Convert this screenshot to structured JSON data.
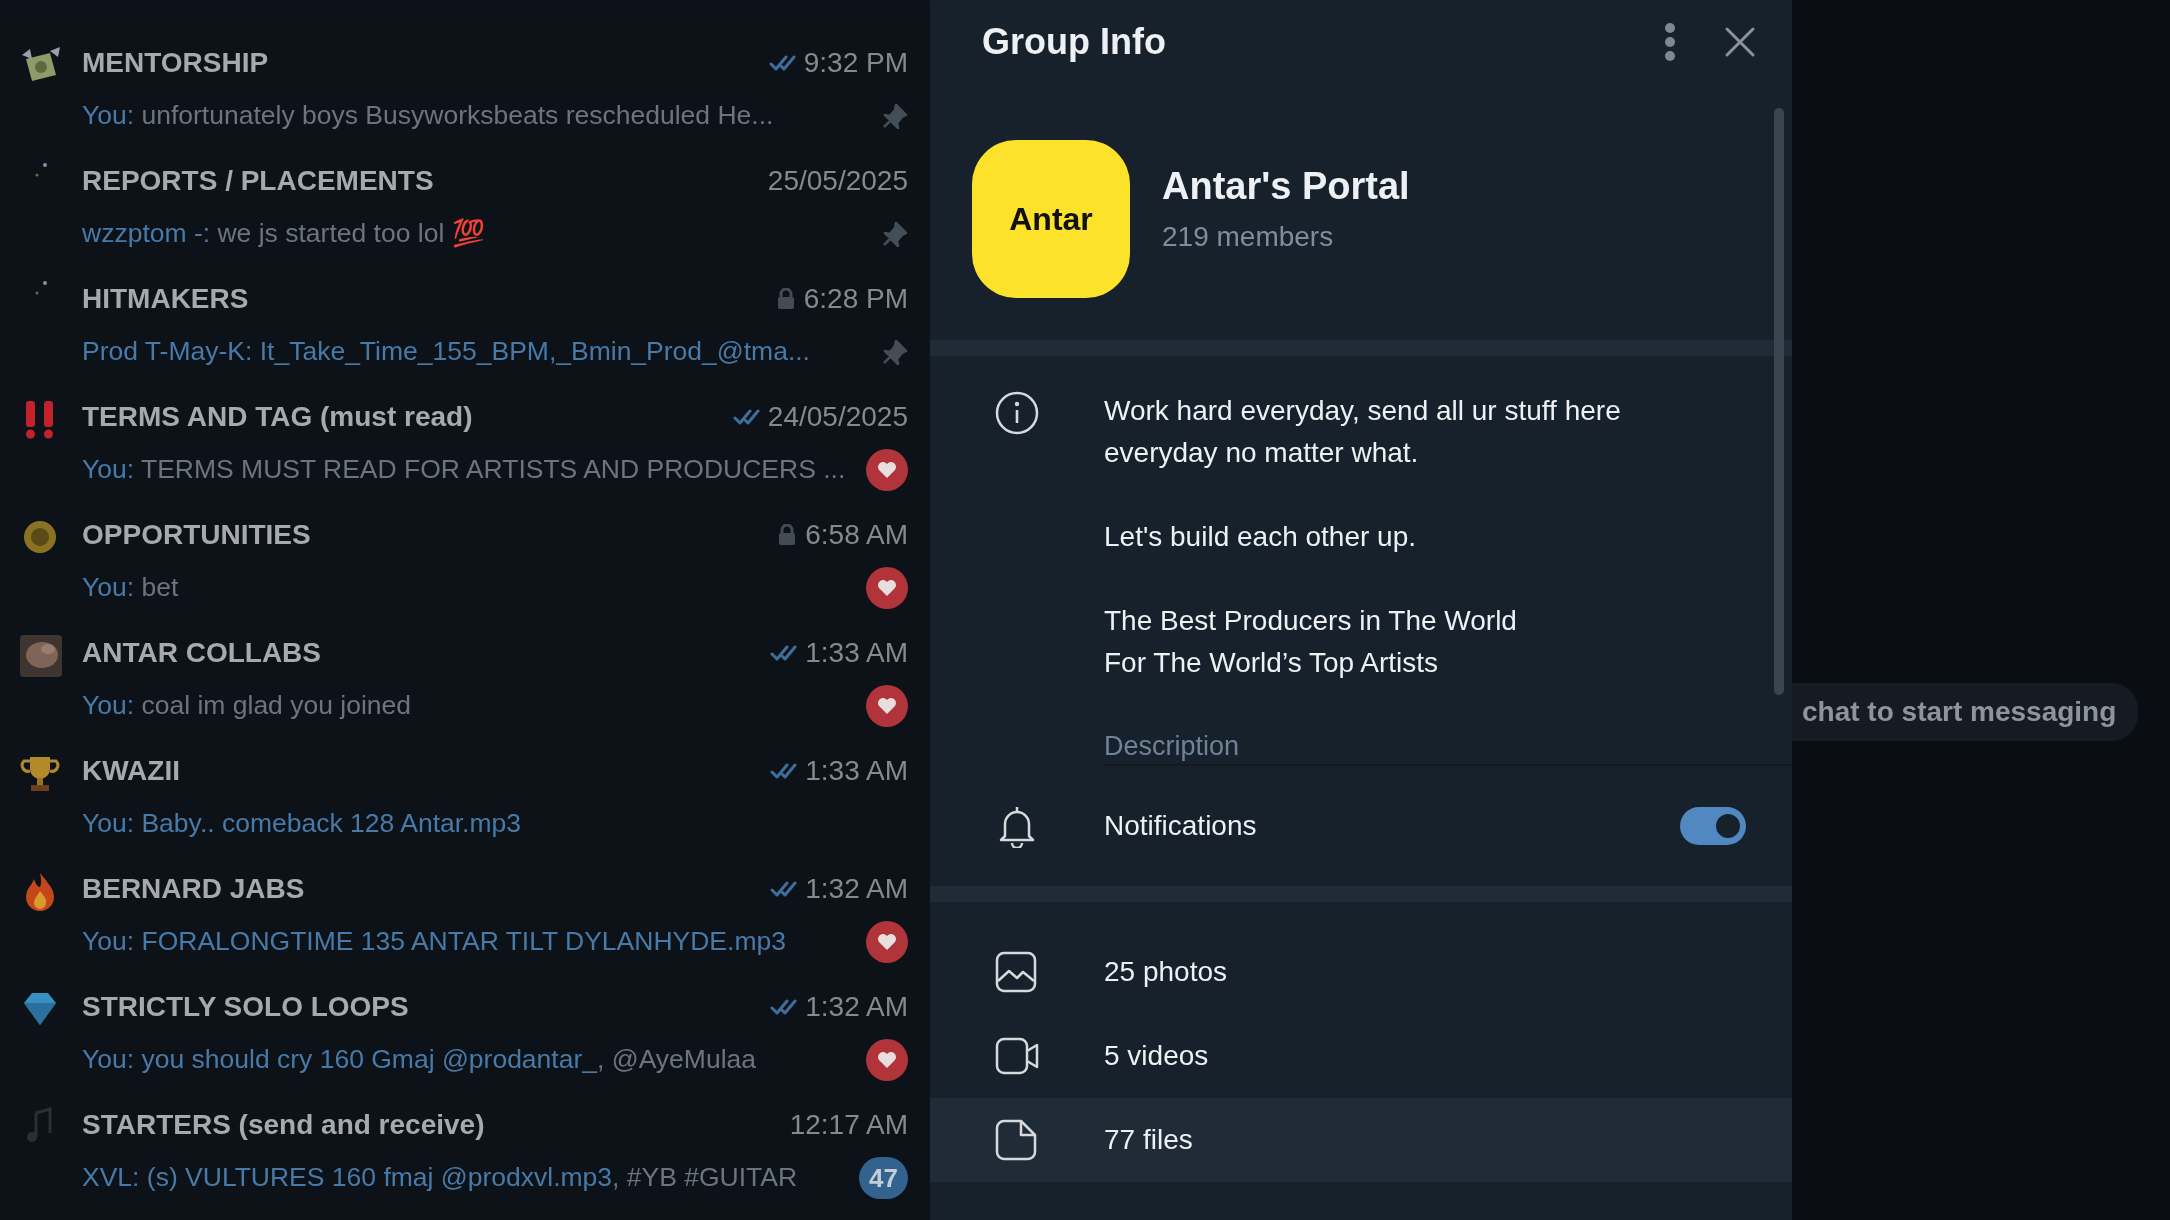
{
  "chats": [
    {
      "kind": "banknote",
      "name": "MENTORSHIP",
      "read": true,
      "locked": false,
      "time": "9:32 PM",
      "preview": [
        {
          "text": "You:",
          "accent": true
        },
        {
          "text": " unfortunately boys Busyworksbeats rescheduled  He...",
          "accent": false
        }
      ],
      "indicator": {
        "kind": "pin"
      }
    },
    {
      "kind": "specks",
      "name": "REPORTS / PLACEMENTS",
      "read": false,
      "locked": false,
      "time": "25/05/2025",
      "preview": [
        {
          "text": "wzzptom -:",
          "accent": true
        },
        {
          "text": " we js started too lol 💯",
          "accent": false
        }
      ],
      "indicator": {
        "kind": "pin"
      }
    },
    {
      "kind": "specks",
      "name": "HITMAKERS",
      "read": false,
      "locked": true,
      "time": "6:28 PM",
      "preview": [
        {
          "text": "Prod T-May-K: It_Take_Time_155_BPM,_Bmin_Prod_@tma...",
          "accent": true
        }
      ],
      "indicator": {
        "kind": "pin"
      }
    },
    {
      "kind": "exclamation",
      "name": "TERMS AND TAG (must read)",
      "read": true,
      "locked": false,
      "time": "24/05/2025",
      "preview": [
        {
          "text": "You:",
          "accent": true
        },
        {
          "text": " TERMS MUST READ FOR ARTISTS AND PRODUCERS  ...",
          "accent": false
        }
      ],
      "indicator": {
        "kind": "reaction"
      }
    },
    {
      "kind": "coin",
      "name": "OPPORTUNITIES",
      "read": false,
      "locked": true,
      "time": "6:58 AM",
      "preview": [
        {
          "text": "You:",
          "accent": true
        },
        {
          "text": " bet",
          "accent": false
        }
      ],
      "indicator": {
        "kind": "reaction"
      }
    },
    {
      "name": "ANTAR COLLABS",
      "read": true,
      "locked": false,
      "time": "1:33 AM",
      "preview": [
        {
          "text": "You:",
          "accent": true
        },
        {
          "text": " coal im glad you joined",
          "accent": false
        }
      ],
      "indicator": {
        "kind": "reaction"
      }
    },
    {
      "kind": "trophy",
      "name": "KWAZII",
      "read": true,
      "locked": false,
      "time": "1:33 AM",
      "preview": [
        {
          "text": "You: Baby.. comeback 128 Antar.mp3",
          "accent": true
        }
      ]
    },
    {
      "kind": "flame",
      "name": "BERNARD JABS",
      "read": true,
      "locked": false,
      "time": "1:32 AM",
      "preview": [
        {
          "text": "You: FORALONGTIME 135 ANTAR TILT DYLANHYDE.mp3",
          "accent": true
        }
      ],
      "indicator": {
        "kind": "reaction"
      }
    },
    {
      "kind": "diamond",
      "name": "STRICTLY SOLO LOOPS",
      "read": true,
      "locked": false,
      "time": "1:32 AM",
      "preview": [
        {
          "text": "You: you should cry 160 Gmaj @prodantar_",
          "accent": true
        },
        {
          "text": ", @AyeMulaa",
          "accent": false
        }
      ],
      "indicator": {
        "kind": "reaction"
      }
    },
    {
      "kind": "note",
      "name": "STARTERS (send and receive)",
      "read": false,
      "locked": false,
      "time": "12:17 AM",
      "preview": [
        {
          "text": "XVL: (s) VULTURES 160 fmaj @prodxvl.mp3",
          "accent": true
        },
        {
          "text": ", #YB #GUITAR",
          "accent": false
        }
      ],
      "indicator": {
        "kind": "unread",
        "count": "47"
      }
    }
  ],
  "panel": {
    "title": "Group Info",
    "group": {
      "avatar_text": "Antar",
      "name": "Antar's Portal",
      "members": "219 members"
    },
    "description": {
      "paragraphs": [
        "Work hard everyday, send all ur stuff here everyday no matter what.",
        "Let's build each other up.",
        "The Best Producers in The World\nFor The World’s Top Artists"
      ],
      "label": "Description"
    },
    "notifications": {
      "label": "Notifications",
      "on": true
    },
    "media": [
      {
        "kind": "photos",
        "label": "25 photos",
        "selected": false
      },
      {
        "kind": "videos",
        "label": "5 videos",
        "selected": false
      },
      {
        "kind": "files",
        "label": "77 files",
        "selected": true
      }
    ]
  },
  "backdrop": {
    "hint": "chat to start messaging"
  }
}
